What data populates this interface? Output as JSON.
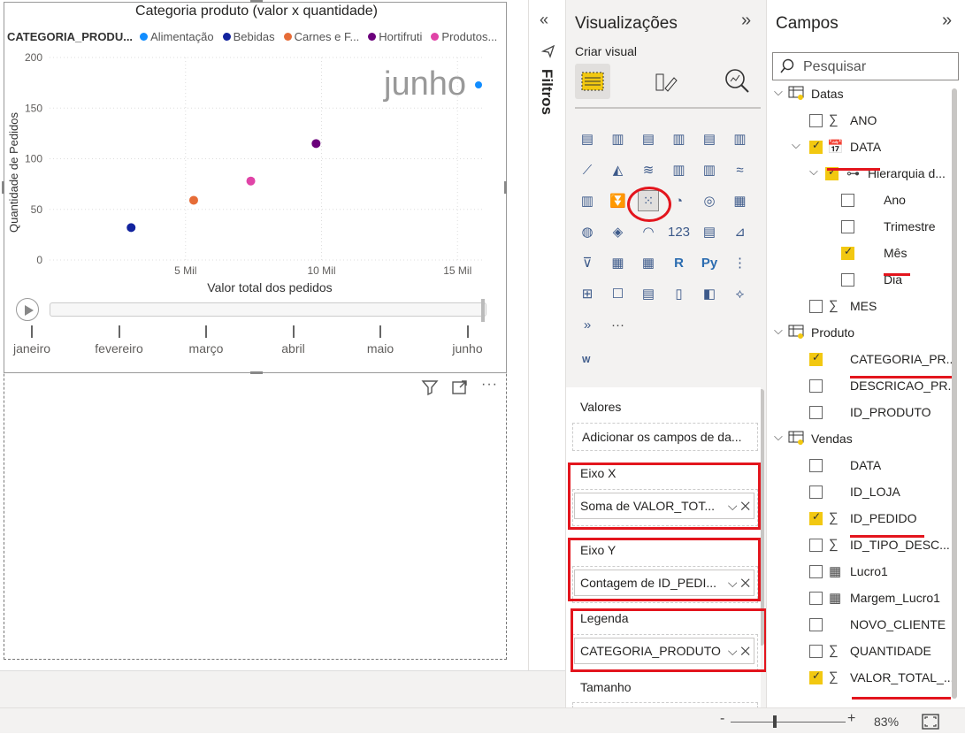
{
  "chart": {
    "title": "Categoria produto (valor x quantidade)",
    "legend_title": "CATEGORIA_PRODU...",
    "legend_items": [
      {
        "label": "Alimentação",
        "color": "#118dff"
      },
      {
        "label": "Bebidas",
        "color": "#12239e"
      },
      {
        "label": "Carnes e F...",
        "color": "#e66c37"
      },
      {
        "label": "Hortifruti",
        "color": "#6b007b"
      },
      {
        "label": "Produtos...",
        "color": "#e044a7"
      }
    ],
    "play_label": "junho",
    "timeline": [
      "janeiro",
      "fevereiro",
      "março",
      "abril",
      "maio",
      "junho"
    ]
  },
  "chart_data": {
    "type": "scatter",
    "title": "Categoria produto (valor x quantidade)",
    "xlabel": "Valor total dos pedidos",
    "ylabel": "Quantidade de Pedidos",
    "xlim": [
      0,
      16000
    ],
    "ylim": [
      0,
      200
    ],
    "x_ticks": [
      "5 Mil",
      "10 Mil",
      "15 Mil"
    ],
    "x_tick_values": [
      5000,
      10000,
      15000
    ],
    "y_ticks": [
      "0",
      "50",
      "100",
      "150",
      "200"
    ],
    "y_tick_values": [
      0,
      50,
      100,
      150,
      200
    ],
    "grid": true,
    "legend_placement": "top",
    "series": [
      {
        "name": "Bebidas",
        "color": "#12239e",
        "x": [
          3000
        ],
        "y": [
          32
        ]
      },
      {
        "name": "Carnes e F...",
        "color": "#e66c37",
        "x": [
          5300
        ],
        "y": [
          59
        ]
      },
      {
        "name": "Produtos...",
        "color": "#e044a7",
        "x": [
          7400
        ],
        "y": [
          78
        ]
      },
      {
        "name": "Hortifruti",
        "color": "#6b007b",
        "x": [
          9800
        ],
        "y": [
          115
        ]
      }
    ]
  },
  "filters_pane": {
    "label": "Filtros"
  },
  "viz_pane": {
    "title": "Visualizações",
    "subtitle": "Criar visual",
    "more": "...",
    "wells": {
      "values_label": "Valores",
      "values_placeholder": "Adicionar os campos de da...",
      "x_label": "Eixo X",
      "x_value": "Soma de VALOR_TOT...",
      "y_label": "Eixo Y",
      "y_value": "Contagem de ID_PEDI...",
      "legend_label": "Legenda",
      "legend_value": "CATEGORIA_PRODUTO",
      "size_label": "Tamanho"
    }
  },
  "fields_pane": {
    "title": "Campos",
    "search_placeholder": "Pesquisar",
    "tables": {
      "datas": "Datas",
      "produto": "Produto",
      "vendas": "Vendas"
    },
    "fields": {
      "ano": "ANO",
      "data": "DATA",
      "hierarquia": "Hierarquia d...",
      "ano_h": "Ano",
      "trimestre": "Trimestre",
      "mes_h": "Mês",
      "dia": "Dia",
      "mes": "MES",
      "categoria": "CATEGORIA_PR...",
      "descricao": "DESCRICAO_PR...",
      "id_produto": "ID_PRODUTO",
      "v_data": "DATA",
      "id_loja": "ID_LOJA",
      "id_pedido": "ID_PEDIDO",
      "id_tipo": "ID_TIPO_DESC...",
      "lucro": "Lucro1",
      "margem": "Margem_Lucro1",
      "novo_cliente": "NOVO_CLIENTE",
      "quantidade": "QUANTIDADE",
      "valor_total": "VALOR_TOTAL_..."
    }
  },
  "status_bar": {
    "zoom": "83%",
    "minus": "-",
    "plus": "+"
  },
  "colors": {
    "accent": "#f2c811",
    "highlight": "#e3151d"
  }
}
